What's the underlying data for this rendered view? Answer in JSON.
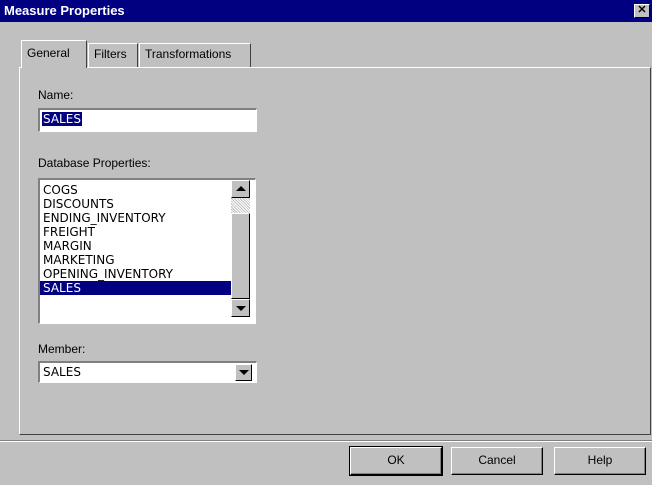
{
  "window": {
    "title": "Measure Properties",
    "close_glyph": "✕"
  },
  "tabs": [
    {
      "label": "General",
      "active": true
    },
    {
      "label": "Filters",
      "active": false
    },
    {
      "label": "Transformations",
      "active": false
    }
  ],
  "name_field": {
    "label": "Name:",
    "value": "SALES"
  },
  "database_properties": {
    "label": "Database Properties:",
    "items": [
      "COGS",
      "DISCOUNTS",
      "ENDING_INVENTORY",
      "FREIGHT",
      "MARGIN",
      "MARKETING",
      "OPENING_INVENTORY",
      "SALES"
    ],
    "selected": "SALES"
  },
  "member": {
    "label": "Member:",
    "value": "SALES"
  },
  "buttons": {
    "ok": "OK",
    "cancel": "Cancel",
    "help": "Help"
  },
  "icons": {
    "close": "close-icon",
    "scroll_up": "arrow-up-icon",
    "scroll_down": "arrow-down-icon",
    "dropdown": "chevron-down-icon"
  },
  "colors": {
    "titlebar": "#000080",
    "selection": "#000080",
    "face": "#c0c0c0"
  }
}
